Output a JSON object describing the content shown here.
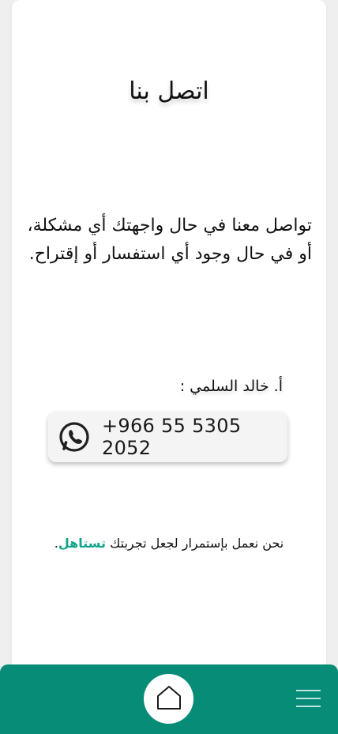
{
  "page": {
    "title": "اتصل بنا",
    "intro_line1": "تواصل معنا في حال واجهتك أي مشكلة،",
    "intro_line2": "أو في حال وجود أي استفسار أو إقتراح."
  },
  "contact": {
    "person_label": "أ. خالد السلمي :",
    "phone": "+966 55 5305 2052",
    "icon": "whatsapp-icon"
  },
  "tagline": {
    "prefix": "نحن نعمل بإستمرار لجعل تجربتك ",
    "brand": "تستاهل",
    "suffix": "."
  },
  "nav": {
    "home_icon": "home-icon",
    "menu_icon": "menu-icon"
  },
  "colors": {
    "accent": "#078c78",
    "brand_text": "#12a58a",
    "whatsapp": "#1f1f1f"
  }
}
